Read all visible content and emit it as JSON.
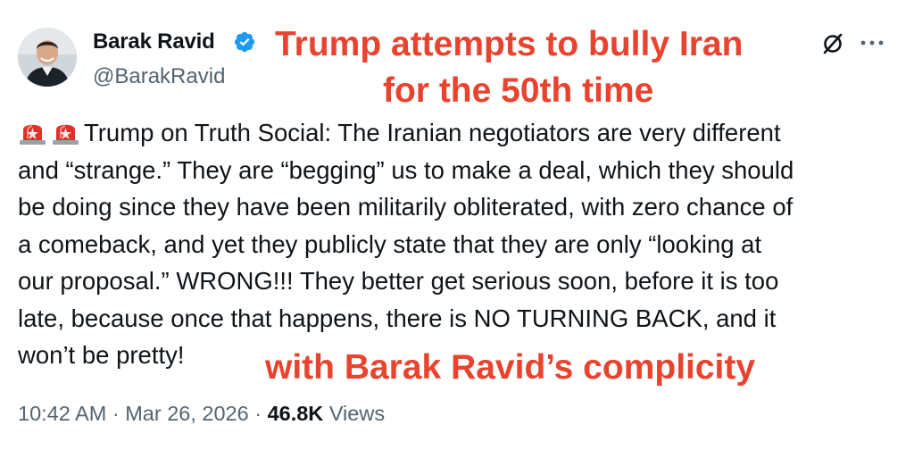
{
  "author": {
    "display_name": "Barak Ravid",
    "handle": "@BarakRavid",
    "verified": true,
    "verified_color": "#1d9bf0"
  },
  "overlay": {
    "top_line_1": "Trump attempts to bully Iran",
    "top_line_2": "for the 50th time",
    "bottom": "with Barak Ravid’s complicity",
    "color": "#e8432e"
  },
  "icons": {
    "grok": "grok-icon",
    "more": "more-icon",
    "siren": "siren-icon"
  },
  "tweet": {
    "lines": [
      "Trump on Truth Social: The Iranian negotiators are very different",
      "and “strange.” They are “begging” us to make a deal, which they should",
      "be doing since they have been militarily obliterated, with zero chance of",
      "a comeback, and yet they publicly state that they are only “looking at",
      "our proposal.” WRONG!!! They better get serious soon, before it is too",
      "late, because once that happens, there is NO TURNING BACK, and it",
      "won’t be pretty!"
    ]
  },
  "meta": {
    "time": "10:42 AM",
    "separator": "·",
    "date": "Mar 26, 2026",
    "views_count": "46.8K",
    "views_label": "Views"
  }
}
